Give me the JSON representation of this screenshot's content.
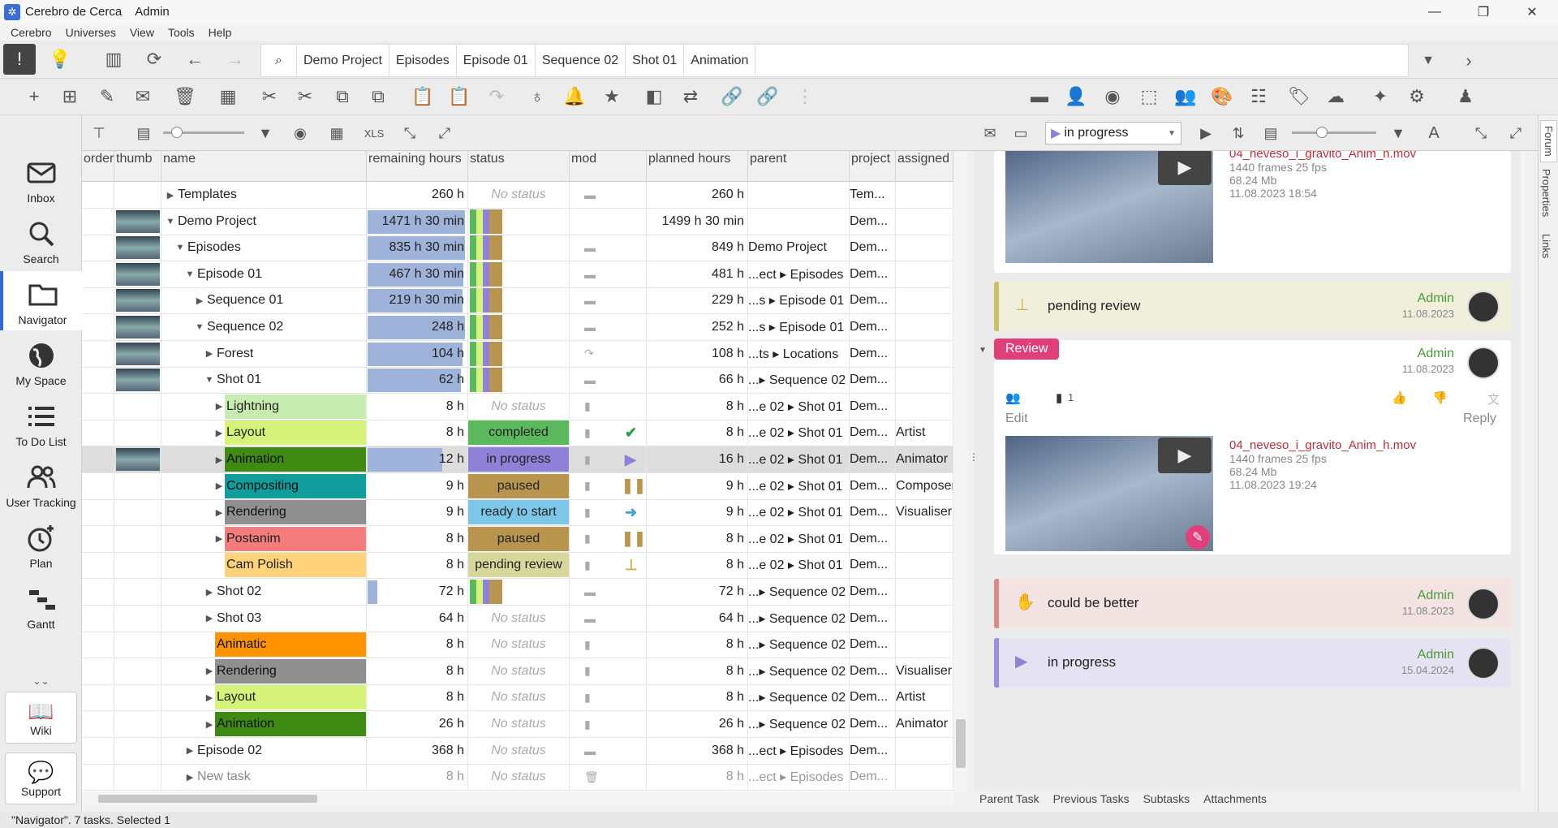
{
  "title": {
    "app": "Cerebro de Cerca",
    "user": "Admin"
  },
  "menu": [
    "Cerebro",
    "Universes",
    "View",
    "Tools",
    "Help"
  ],
  "breadcrumbs": [
    "Demo Project",
    "Episodes",
    "Episode 01",
    "Sequence 02",
    "Shot 01",
    "Animation"
  ],
  "sidebar": {
    "items": [
      {
        "label": "Inbox",
        "icon": "inbox-icon"
      },
      {
        "label": "Search",
        "icon": "search-icon"
      },
      {
        "label": "Navigator",
        "icon": "folder-icon"
      },
      {
        "label": "My Space",
        "icon": "globe-icon"
      },
      {
        "label": "To Do List",
        "icon": "list-icon"
      },
      {
        "label": "User Tracking",
        "icon": "users-icon"
      },
      {
        "label": "Plan",
        "icon": "clock-plus-icon"
      },
      {
        "label": "Gantt",
        "icon": "gantt-icon"
      }
    ],
    "wiki": "Wiki",
    "support": "Support"
  },
  "grid": {
    "columns": [
      "order",
      "thumb",
      "name",
      "remaining hours",
      "status",
      "mod",
      "planned hours",
      "parent",
      "project",
      "assigned"
    ],
    "rows": [
      {
        "indent": 0,
        "tri": "▶",
        "name": "Templates",
        "rem": "260 h",
        "status": "No status",
        "mod": "folder",
        "plan": "260 h",
        "parent": "",
        "proj": "Tem...",
        "asg": "",
        "thumb": false
      },
      {
        "indent": 0,
        "tri": "▼",
        "name": "Demo Project",
        "rem": "1471 h 30 min",
        "status": "",
        "mod": "",
        "plan": "1499 h 30 min",
        "parent": "",
        "proj": "Dem...",
        "asg": "",
        "thumb": true,
        "pct": 0.98
      },
      {
        "indent": 1,
        "tri": "▼",
        "name": "Episodes",
        "rem": "835 h 30 min",
        "status": "",
        "mod": "folder",
        "plan": "849 h",
        "parent": "Demo Project",
        "proj": "Dem...",
        "asg": "",
        "thumb": true,
        "pct": 0.98
      },
      {
        "indent": 2,
        "tri": "▼",
        "name": "Episode 01",
        "rem": "467 h 30 min",
        "status": "",
        "mod": "folder",
        "plan": "481 h",
        "parent": "...ect ▸ Episodes",
        "proj": "Dem...",
        "asg": "",
        "thumb": true,
        "pct": 0.97
      },
      {
        "indent": 3,
        "tri": "▶",
        "name": "Sequence 01",
        "rem": "219 h 30 min",
        "status": "",
        "mod": "folder",
        "plan": "229 h",
        "parent": "...s ▸ Episode 01",
        "proj": "Dem...",
        "asg": "",
        "thumb": true,
        "pct": 0.96
      },
      {
        "indent": 3,
        "tri": "▼",
        "name": "Sequence 02",
        "rem": "248 h",
        "status": "",
        "mod": "folder",
        "plan": "252 h",
        "parent": "...s ▸ Episode 01",
        "proj": "Dem...",
        "asg": "",
        "thumb": true,
        "pct": 0.98
      },
      {
        "indent": 4,
        "tri": "▶",
        "name": "Forest",
        "rem": "104 h",
        "status": "",
        "mod": "link",
        "plan": "108 h",
        "parent": "...ts ▸ Locations",
        "proj": "Dem...",
        "asg": "",
        "thumb": true,
        "pct": 0.96
      },
      {
        "indent": 4,
        "tri": "▼",
        "name": "Shot 01",
        "rem": "62 h",
        "status": "",
        "mod": "folder",
        "plan": "66 h",
        "parent": "...▸ Sequence 02",
        "proj": "Dem...",
        "asg": "",
        "thumb": true,
        "pct": 0.94
      },
      {
        "indent": 5,
        "tri": "▶",
        "name": "Lightning",
        "rem": "8 h",
        "status": "No status",
        "mod": "task",
        "plan": "8 h",
        "parent": "...e 02 ▸ Shot 01",
        "proj": "Dem...",
        "asg": "",
        "color": "#c8ecb0"
      },
      {
        "indent": 5,
        "tri": "▶",
        "name": "Layout",
        "rem": "8 h",
        "status": "completed",
        "statusColor": "#5cb85c",
        "mod": "task",
        "icon": "✔",
        "iconColor": "#2e9e4a",
        "plan": "8 h",
        "parent": "...e 02 ▸ Shot 01",
        "proj": "Dem...",
        "asg": "Artist",
        "color": "#d6f27a"
      },
      {
        "indent": 5,
        "tri": "▶",
        "name": "Animation",
        "rem": "12 h",
        "status": "in progress",
        "statusColor": "#8f80d8",
        "mod": "task",
        "icon": "▶",
        "iconColor": "#8f80d8",
        "plan": "16 h",
        "parent": "...e 02 ▸ Shot 01",
        "proj": "Dem...",
        "asg": "Animator",
        "color": "#3f8a12",
        "sel": true,
        "thumb": true,
        "pct": 0.75
      },
      {
        "indent": 5,
        "tri": "▶",
        "name": "Compositing",
        "rem": "9 h",
        "status": "paused",
        "statusColor": "#b8954e",
        "mod": "task",
        "icon": "❚❚",
        "iconColor": "#b8954e",
        "plan": "9 h",
        "parent": "...e 02 ▸ Shot 01",
        "proj": "Dem...",
        "asg": "Composer",
        "color": "#139c9c"
      },
      {
        "indent": 5,
        "tri": "▶",
        "name": "Rendering",
        "rem": "9 h",
        "status": "ready to start",
        "statusColor": "#7ec6e8",
        "mod": "task",
        "icon": "➜",
        "iconColor": "#4a9fd6",
        "plan": "9 h",
        "parent": "...e 02 ▸ Shot 01",
        "proj": "Dem...",
        "asg": "Visualiser",
        "color": "#8f8f8f"
      },
      {
        "indent": 5,
        "tri": "▶",
        "name": "Postanim",
        "rem": "8 h",
        "status": "paused",
        "statusColor": "#b8954e",
        "mod": "task",
        "icon": "❚❚",
        "iconColor": "#b8954e",
        "plan": "8 h",
        "parent": "...e 02 ▸ Shot 01",
        "proj": "Dem...",
        "asg": "",
        "color": "#f47c7c"
      },
      {
        "indent": 5,
        "tri": "",
        "name": "Cam Polish",
        "rem": "8 h",
        "status": "pending review",
        "statusColor": "#d6d79a",
        "mod": "task",
        "icon": "⊥",
        "iconColor": "#c6b452",
        "plan": "8 h",
        "parent": "...e 02 ▸ Shot 01",
        "proj": "Dem...",
        "asg": "",
        "color": "#ffd27c"
      },
      {
        "indent": 4,
        "tri": "▶",
        "name": "Shot 02",
        "rem": "72 h",
        "status": "",
        "mod": "folder",
        "plan": "72 h",
        "parent": "...▸ Sequence 02",
        "proj": "Dem...",
        "asg": "",
        "pct": 0.1
      },
      {
        "indent": 4,
        "tri": "▶",
        "name": "Shot 03",
        "rem": "64 h",
        "status": "No status",
        "mod": "folder",
        "plan": "64 h",
        "parent": "...▸ Sequence 02",
        "proj": "Dem...",
        "asg": ""
      },
      {
        "indent": 4,
        "tri": "",
        "name": "Animatic",
        "rem": "8 h",
        "status": "No status",
        "mod": "task",
        "plan": "8 h",
        "parent": "...▸ Sequence 02",
        "proj": "Dem...",
        "asg": "",
        "color": "#ff9200"
      },
      {
        "indent": 4,
        "tri": "▶",
        "name": "Rendering",
        "rem": "8 h",
        "status": "No status",
        "mod": "task",
        "plan": "8 h",
        "parent": "...▸ Sequence 02",
        "proj": "Dem...",
        "asg": "Visualiser",
        "color": "#8f8f8f"
      },
      {
        "indent": 4,
        "tri": "▶",
        "name": "Layout",
        "rem": "8 h",
        "status": "No status",
        "mod": "task",
        "plan": "8 h",
        "parent": "...▸ Sequence 02",
        "proj": "Dem...",
        "asg": "Artist",
        "color": "#d6f27a"
      },
      {
        "indent": 4,
        "tri": "▶",
        "name": "Animation",
        "rem": "26 h",
        "status": "No status",
        "mod": "task",
        "plan": "26 h",
        "parent": "...▸ Sequence 02",
        "proj": "Dem...",
        "asg": "Animator",
        "color": "#3f8a12"
      },
      {
        "indent": 2,
        "tri": "▶",
        "name": "Episode 02",
        "rem": "368 h",
        "status": "No status",
        "mod": "folder",
        "plan": "368 h",
        "parent": "...ect ▸ Episodes",
        "proj": "Dem...",
        "asg": ""
      },
      {
        "indent": 2,
        "tri": "▶",
        "name": "New task",
        "rem": "8 h",
        "status": "No status",
        "mod": "trash",
        "plan": "8 h",
        "parent": "...ect ▸ Episodes",
        "proj": "Dem...",
        "asg": "",
        "dim": true
      }
    ]
  },
  "right_toolbar": {
    "status_select": "in progress"
  },
  "forum": {
    "attachment1": {
      "file": "04_neveso_i_gravito_Anim_h.mov",
      "frames": "1440 frames 25 fps",
      "size": "68.24 Mb",
      "date": "11.08.2023 18:54"
    },
    "event1": {
      "label": "pending review",
      "user": "Admin",
      "date": "11.08.2023",
      "color": "#c9c06a",
      "bg": "#f0efdc"
    },
    "review": {
      "badge": "Review",
      "user": "Admin",
      "date": "11.08.2023",
      "attach_count": "1",
      "edit": "Edit",
      "reply": "Reply",
      "attachment": {
        "file": "04_neveso_i_gravito_Anim_h.mov",
        "frames": "1440 frames 25 fps",
        "size": "68.24 Mb",
        "date": "11.08.2023 19:24"
      }
    },
    "event2": {
      "label": "could be better",
      "user": "Admin",
      "date": "11.08.2023",
      "color": "#d98a8a",
      "bg": "#f3e3e3"
    },
    "event3": {
      "label": "in progress",
      "user": "Admin",
      "date": "15.04.2024",
      "color": "#9a8fe0",
      "bg": "#e5e3f3"
    }
  },
  "right_tabs": [
    "Parent Task",
    "Previous Tasks",
    "Subtasks",
    "Attachments"
  ],
  "vertical_tabs": [
    "Forum",
    "Properties",
    "Links"
  ],
  "statusbar": "\"Navigator\". 7 tasks. Selected 1"
}
